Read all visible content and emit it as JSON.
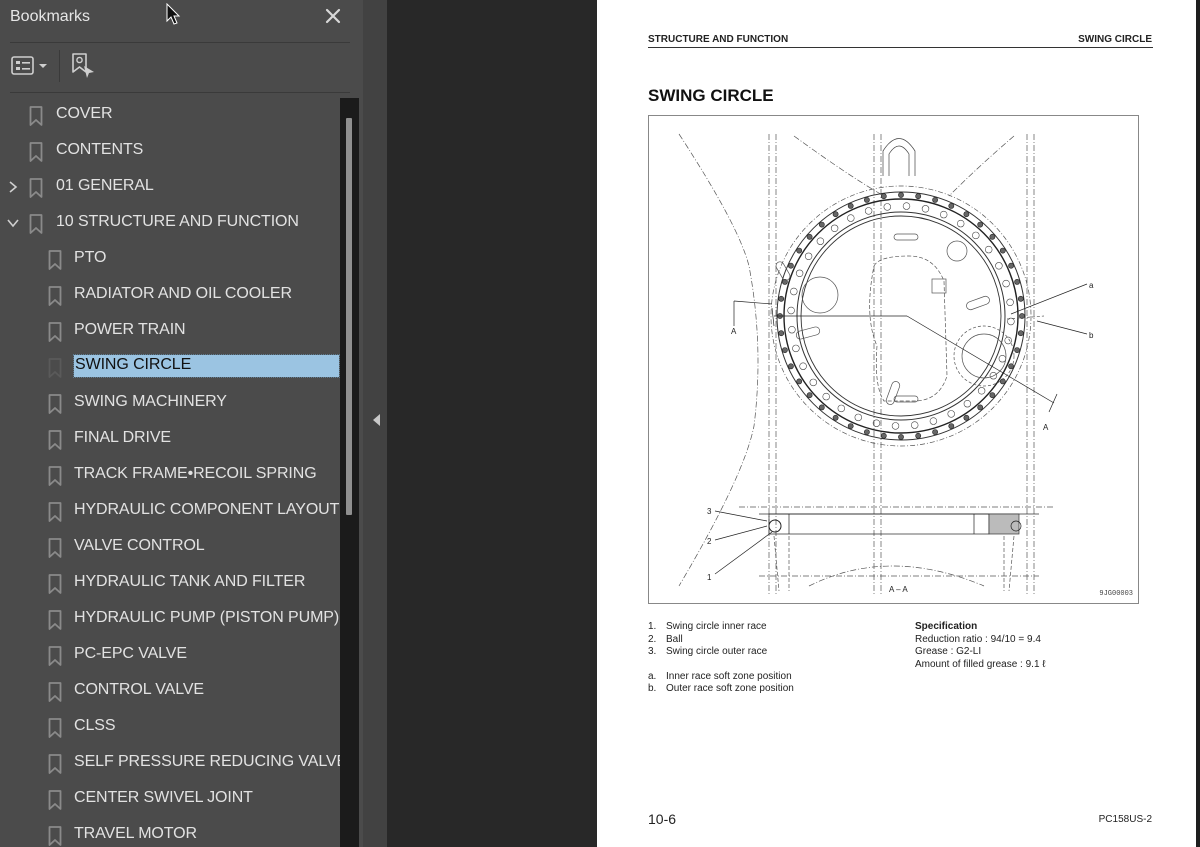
{
  "sidebar": {
    "title": "Bookmarks",
    "close_icon": "close-icon",
    "toolbar": {
      "options_icon": "bookmark-options-icon",
      "new_bookmark_icon": "new-bookmark-icon"
    },
    "items": [
      {
        "label": "COVER",
        "level": 0,
        "expander": "none",
        "selected": false
      },
      {
        "label": "CONTENTS",
        "level": 0,
        "expander": "none",
        "selected": false
      },
      {
        "label": "01 GENERAL",
        "level": 0,
        "expander": "collapsed",
        "selected": false
      },
      {
        "label": "10 STRUCTURE AND FUNCTION",
        "level": 0,
        "expander": "expanded",
        "selected": false
      },
      {
        "label": "PTO",
        "level": 1,
        "expander": "none",
        "selected": false
      },
      {
        "label": "RADIATOR AND OIL COOLER",
        "level": 1,
        "expander": "none",
        "selected": false
      },
      {
        "label": "POWER TRAIN",
        "level": 1,
        "expander": "none",
        "selected": false
      },
      {
        "label": "SWING CIRCLE",
        "level": 1,
        "expander": "none",
        "selected": true
      },
      {
        "label": "SWING MACHINERY",
        "level": 1,
        "expander": "none",
        "selected": false
      },
      {
        "label": "FINAL DRIVE",
        "level": 1,
        "expander": "none",
        "selected": false
      },
      {
        "label": "TRACK FRAME•RECOIL SPRING",
        "level": 1,
        "expander": "none",
        "selected": false
      },
      {
        "label": "HYDRAULIC COMPONENT LAYOUT",
        "level": 1,
        "expander": "none",
        "selected": false
      },
      {
        "label": "VALVE CONTROL",
        "level": 1,
        "expander": "none",
        "selected": false
      },
      {
        "label": "HYDRAULIC TANK AND FILTER",
        "level": 1,
        "expander": "none",
        "selected": false
      },
      {
        "label": "HYDRAULIC PUMP (PISTON PUMP)",
        "level": 1,
        "expander": "none",
        "selected": false
      },
      {
        "label": "PC-EPC VALVE",
        "level": 1,
        "expander": "none",
        "selected": false
      },
      {
        "label": "CONTROL VALVE",
        "level": 1,
        "expander": "none",
        "selected": false
      },
      {
        "label": "CLSS",
        "level": 1,
        "expander": "none",
        "selected": false
      },
      {
        "label": "SELF PRESSURE REDUCING VALVE",
        "level": 1,
        "expander": "none",
        "selected": false
      },
      {
        "label": "CENTER SWIVEL JOINT",
        "level": 1,
        "expander": "none",
        "selected": false
      },
      {
        "label": "TRAVEL MOTOR",
        "level": 1,
        "expander": "none",
        "selected": false
      }
    ],
    "collapse_icon": "collapse-panel-left-icon"
  },
  "page": {
    "header_left": "STRUCTURE AND FUNCTION",
    "header_right": "SWING CIRCLE",
    "title": "SWING CIRCLE",
    "figure": {
      "callouts": {
        "a": "a",
        "b": "b",
        "one": "1",
        "two": "2",
        "three": "3",
        "section_mark": "A"
      },
      "section_label": "A – A",
      "drawing_code": "9JG00003"
    },
    "parts": [
      {
        "num": "1.",
        "text": "Swing circle inner race"
      },
      {
        "num": "2.",
        "text": "Ball"
      },
      {
        "num": "3.",
        "text": "Swing circle outer race"
      }
    ],
    "positions": [
      {
        "num": "a.",
        "text": "Inner race soft zone position"
      },
      {
        "num": "b.",
        "text": "Outer race soft zone position"
      }
    ],
    "specification": {
      "title": "Specification",
      "lines": [
        "Reduction ratio : 94/10 = 9.4",
        "Grease : G2-LI",
        "Amount of filled grease : 9.1 ℓ"
      ]
    },
    "page_number": "10-6",
    "model": "PC158US-2"
  }
}
